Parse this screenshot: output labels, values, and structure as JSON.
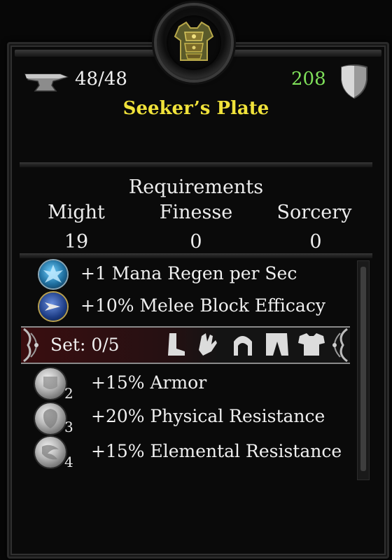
{
  "item": {
    "durability": "48/48",
    "armor": "208",
    "name": "Seeker’s Plate",
    "icon": "armor-chestplate-icon"
  },
  "requirements": {
    "title": "Requirements",
    "stats": [
      {
        "name": "Might",
        "value": "19"
      },
      {
        "name": "Finesse",
        "value": "0"
      },
      {
        "name": "Sorcery",
        "value": "0"
      }
    ]
  },
  "properties": [
    {
      "text": "+1 Mana Regen per Sec",
      "icon": "mana-regen-icon",
      "color": "#3aa0d8"
    },
    {
      "text": "+10% Melee Block Efficacy",
      "icon": "melee-block-icon",
      "color": "#2a52a8"
    }
  ],
  "set": {
    "label": "Set: 0/5",
    "pieces": [
      "boots-icon",
      "gloves-icon",
      "helmet-icon",
      "pants-icon",
      "chest-icon"
    ]
  },
  "set_bonuses": [
    {
      "count": "2",
      "text": "+15% Armor",
      "icon": "armor-bonus-icon"
    },
    {
      "count": "3",
      "text": "+20% Physical Resistance",
      "icon": "physical-resist-icon"
    },
    {
      "count": "4",
      "text": "+15% Elemental Resistance",
      "icon": "elemental-resist-icon"
    }
  ],
  "colors": {
    "name": "#f0e23a",
    "armor_value": "#7fe05a",
    "text": "#f0f0f0"
  }
}
